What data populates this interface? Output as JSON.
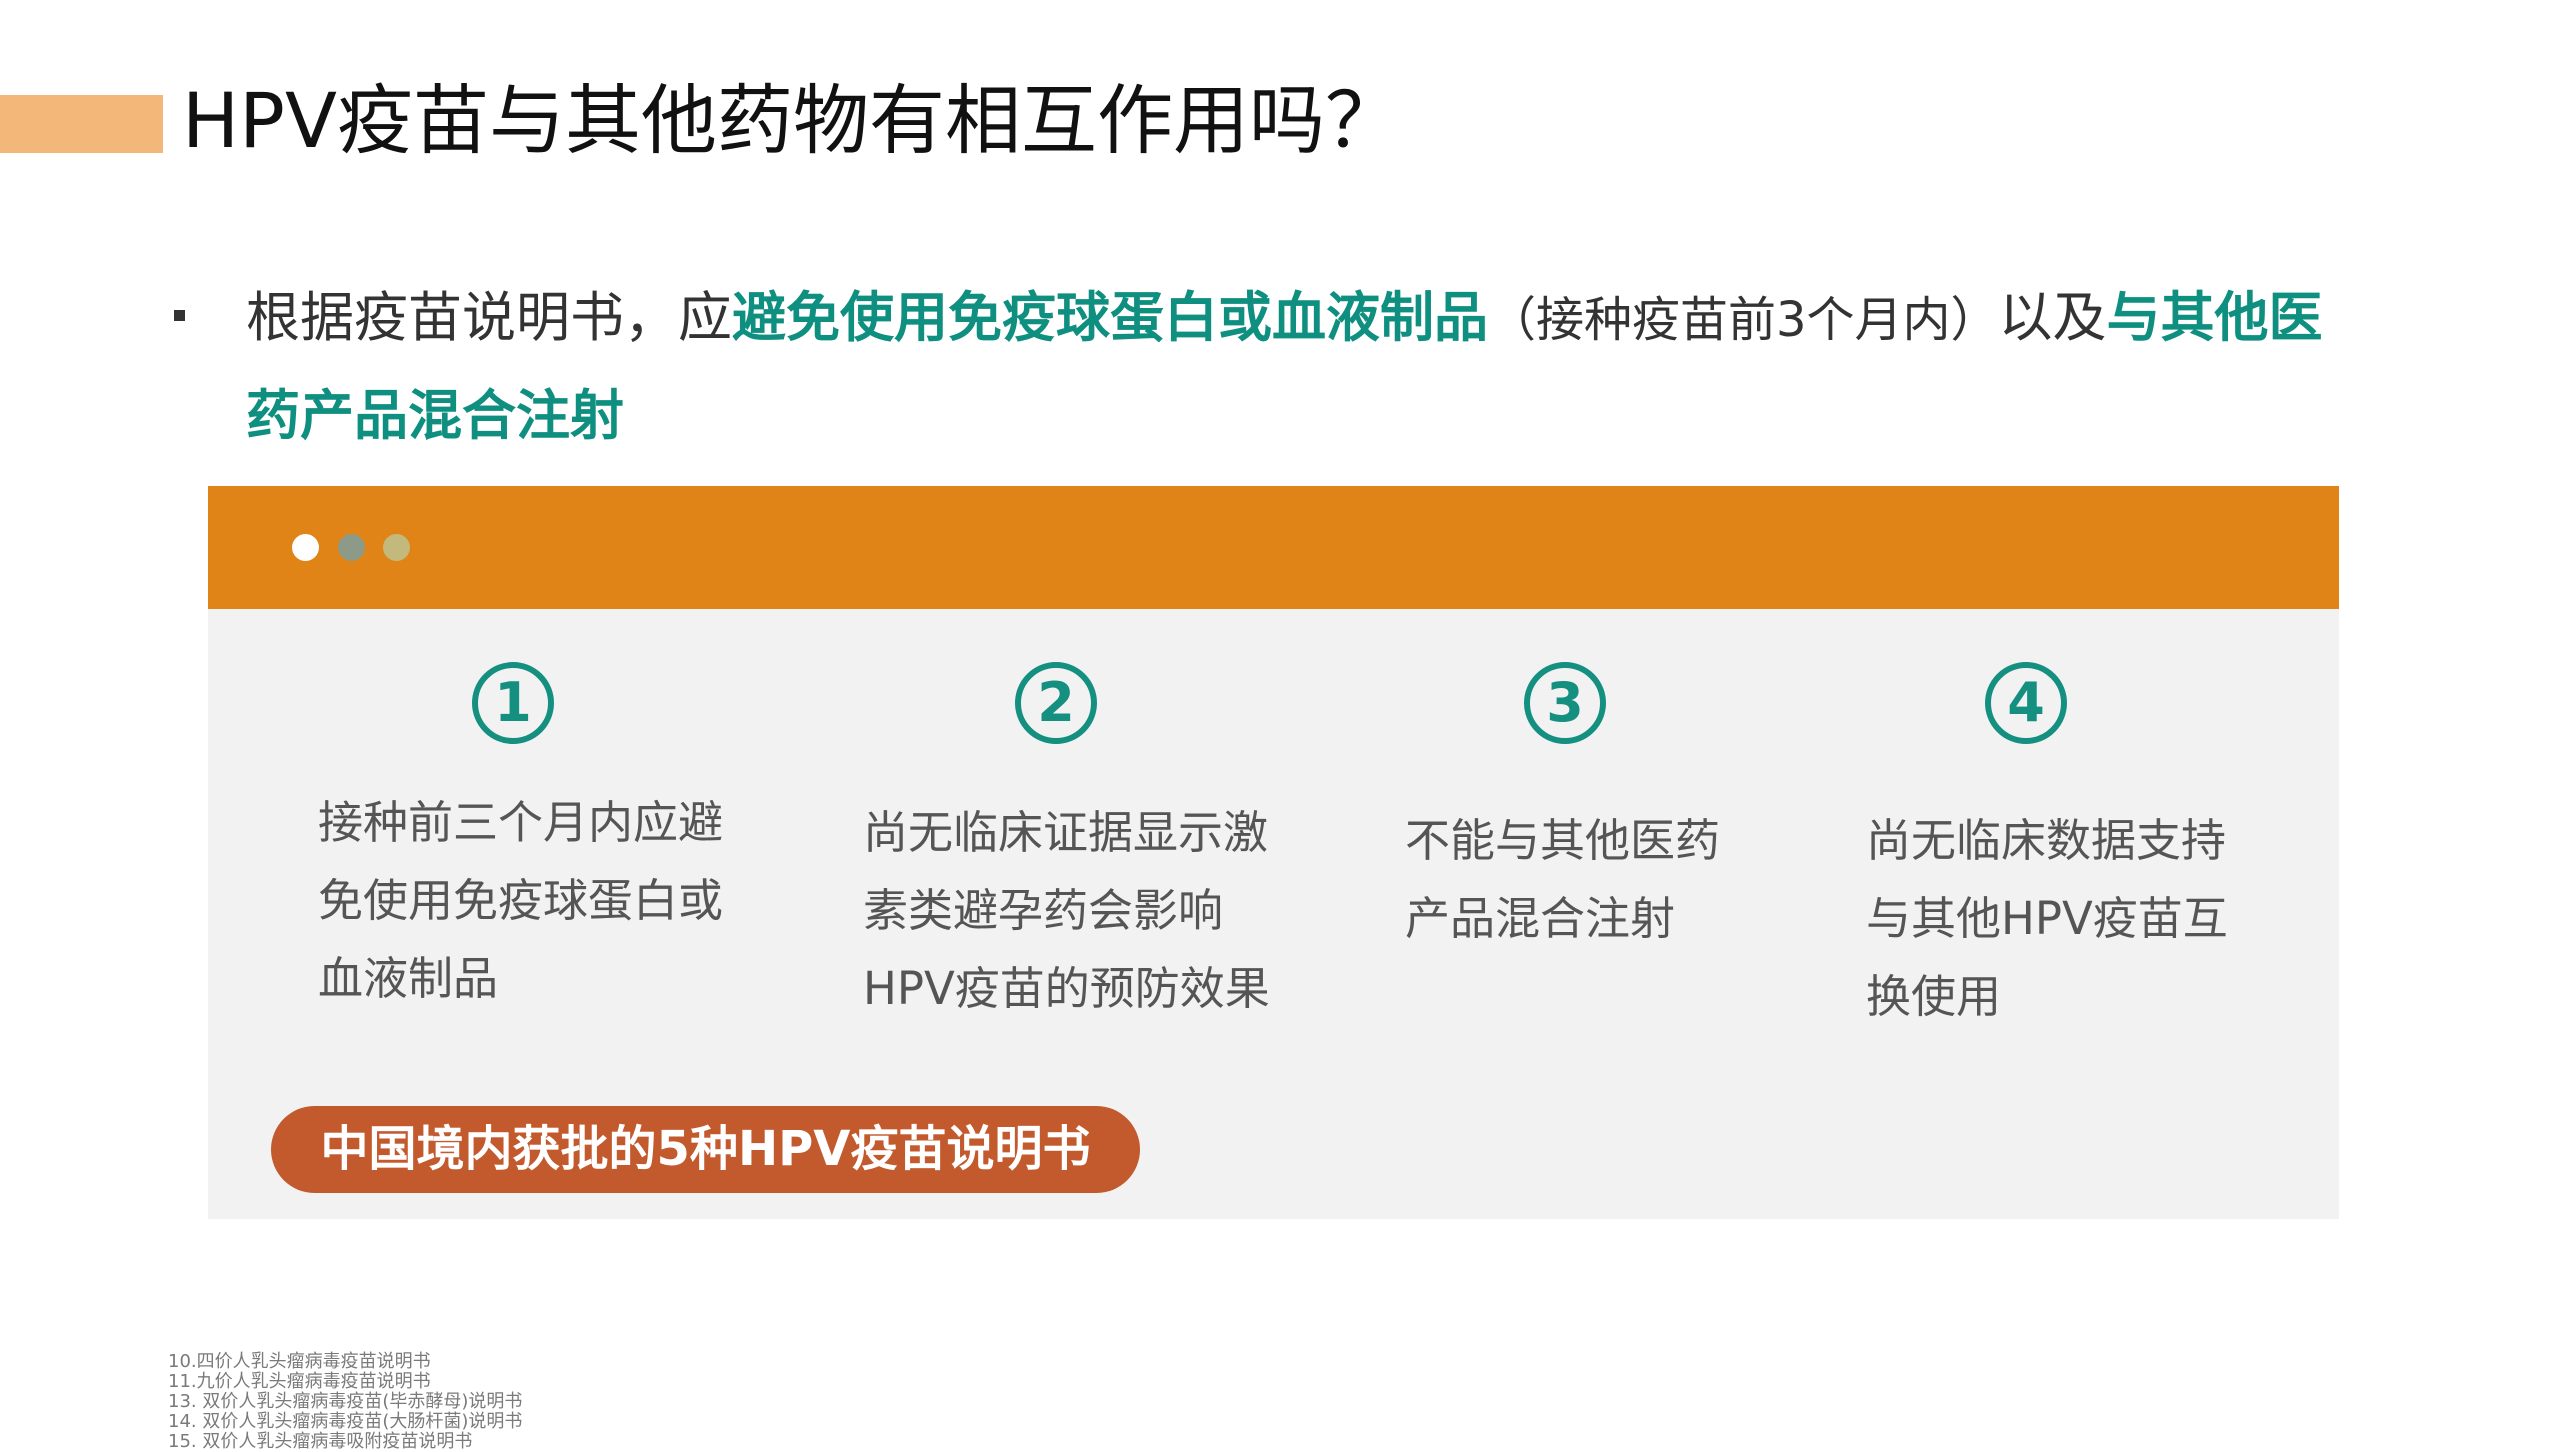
{
  "title": "HPV疫苗与其他药物有相互作用吗？",
  "bullet": {
    "prefix": "根据疫苗说明书，应",
    "highlight1": "避免使用免疫球蛋白或血液制品",
    "paren": "（接种疫苗前3个月内）",
    "middle": "以及",
    "highlight2_line1": "与其他医",
    "highlight2_line2": "药产品混合注射"
  },
  "panel": {
    "items": [
      {
        "number": "1",
        "lines": [
          "接种前三个月内应避",
          "免使用免疫球蛋白或",
          "血液制品"
        ]
      },
      {
        "number": "2",
        "lines": [
          "尚无临床证据显示激",
          "素类避孕药会影响",
          "HPV疫苗的预防效果"
        ]
      },
      {
        "number": "3",
        "lines": [
          "不能与其他医药",
          "产品混合注射"
        ]
      },
      {
        "number": "4",
        "lines": [
          "尚无临床数据支持",
          "与其他HPV疫苗互",
          "换使用"
        ]
      }
    ],
    "source_label": "中国境内获批的5种HPV疫苗说明书"
  },
  "references": [
    "10.四价人乳头瘤病毒疫苗说明书",
    "11.九价人乳头瘤病毒疫苗说明书",
    "13. 双价人乳头瘤病毒疫苗(毕赤酵母)说明书",
    "14. 双价人乳头瘤病毒疫苗(大肠杆菌)说明书",
    "15. 双价人乳头瘤病毒吸附疫苗说明书"
  ],
  "colors": {
    "accent_bar": "#f4b77a",
    "header_bar": "#e08417",
    "highlight_text": "#0f8f80",
    "pill": "#c25a2d"
  }
}
